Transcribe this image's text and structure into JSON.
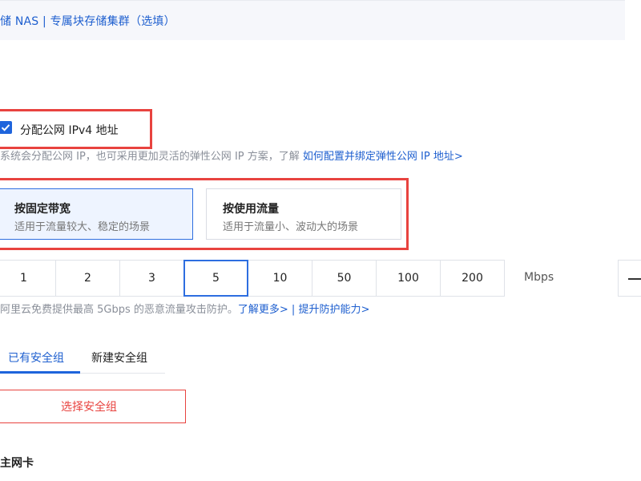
{
  "storage": {
    "link_text": "储 NAS | 专属块存储集群（选填）"
  },
  "ipv4": {
    "checked": true,
    "label": "分配公网 IPv4 地址",
    "hint_text": "系统会分配公网 IP，也可采用更加灵活的弹性公网 IP 方案，了解 ",
    "hint_link": "如何配置并绑定弹性公网 IP 地址>"
  },
  "billing": {
    "options": [
      {
        "title": "按固定带宽",
        "desc": "适用于流量较大、稳定的场景",
        "selected": true
      },
      {
        "title": "按使用流量",
        "desc": "适用于流量小、波动大的场景",
        "selected": false
      }
    ]
  },
  "bandwidth": {
    "options": [
      "1",
      "2",
      "3",
      "5",
      "10",
      "50",
      "100",
      "200"
    ],
    "selected": "5",
    "unit": "Mbps"
  },
  "protection": {
    "text": "阿里云免费提供最高 5Gbps 的恶意流量攻击防护。",
    "learn_more": "了解更多>",
    "separator": " | ",
    "upgrade": "提升防护能力>"
  },
  "security_group": {
    "tabs": [
      "已有安全组",
      "新建安全组"
    ],
    "active_tab": "已有安全组",
    "select_button": "选择安全组"
  },
  "nic": {
    "label": "主网卡"
  },
  "colors": {
    "accent_blue": "#1e64dc",
    "highlight_red": "#e8433f"
  }
}
